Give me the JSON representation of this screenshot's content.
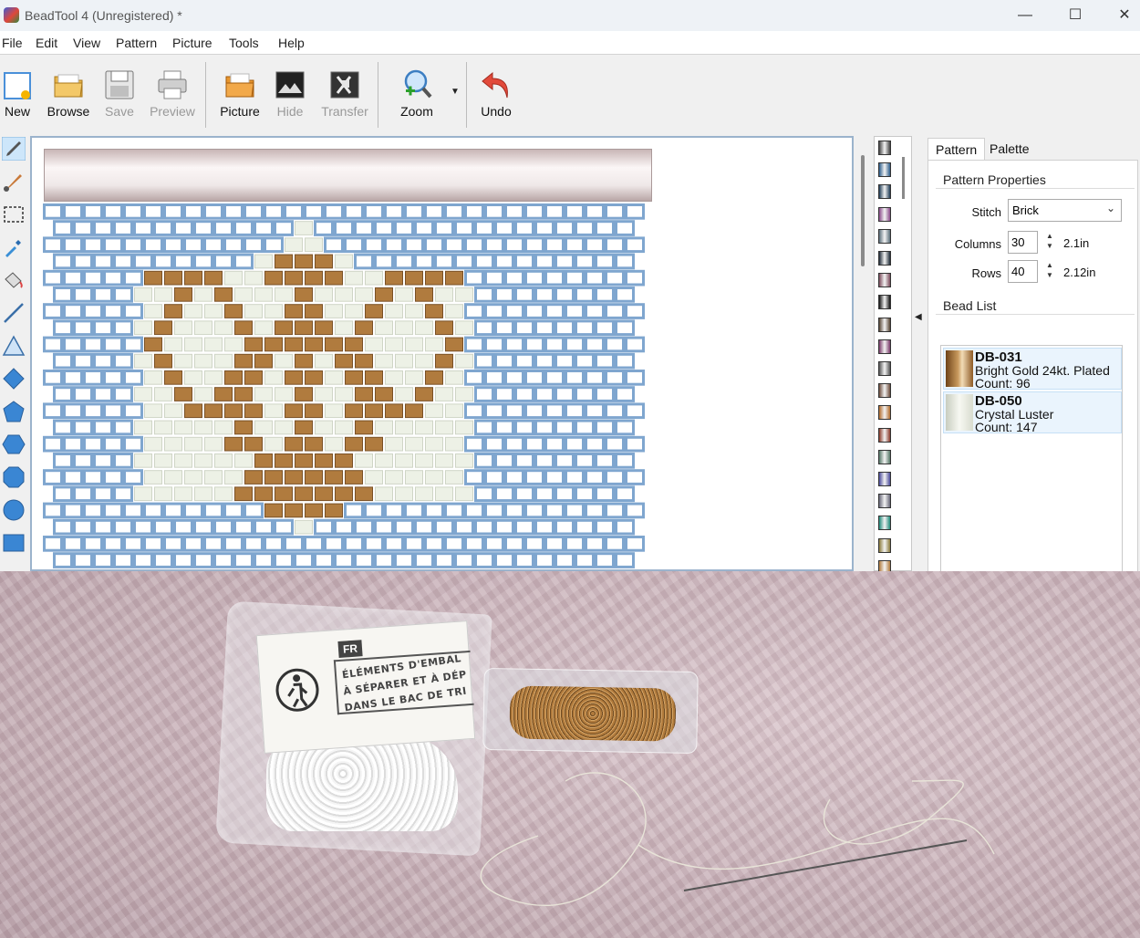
{
  "window": {
    "title": "BeadTool 4 (Unregistered) *"
  },
  "menu": [
    "File",
    "Edit",
    "View",
    "Pattern",
    "Picture",
    "Tools",
    "Help"
  ],
  "toolbar": {
    "new_label": "New",
    "browse_label": "Browse",
    "save_label": "Save",
    "preview_label": "Preview",
    "picture_label": "Picture",
    "hide_label": "Hide",
    "transfer_label": "Transfer",
    "zoom_label": "Zoom",
    "undo_label": "Undo"
  },
  "tools": [
    "pencil-icon",
    "brush-icon",
    "select-rect-icon",
    "eyedropper-icon",
    "fill-bucket-icon",
    "line-icon",
    "triangle-icon",
    "diamond-icon",
    "pentagon-icon",
    "hexagon-icon",
    "octagon-icon",
    "circle-icon",
    "rectangle-icon"
  ],
  "pattern": {
    "bead_colors": {
      "background": "#7fa6cf",
      "gold": "#b07b3e",
      "crystal": "#edf1e6"
    }
  },
  "palette_colors": [
    "#444444",
    "#2b5c8a",
    "#1f3b55",
    "#8a4a8a",
    "#5a6e7a",
    "#1e2a36",
    "#7a4a5a",
    "#111111",
    "#554433",
    "#7a3a6a",
    "#555555",
    "#6b4b3b",
    "#b06a2a",
    "#8a3a2a",
    "#557766",
    "#4a4a9a",
    "#666677",
    "#1f8a7a",
    "#8a7a3a",
    "#b07a3a"
  ],
  "right_panel": {
    "tabs": [
      "Pattern",
      "Palette"
    ],
    "pattern_properties": {
      "title": "Pattern Properties",
      "stitch_label": "Stitch",
      "stitch_value": "Brick",
      "columns_label": "Columns",
      "columns_value": "30",
      "columns_size": "2.1in",
      "rows_label": "Rows",
      "rows_value": "40",
      "rows_size": "2.12in"
    },
    "bead_list": {
      "title": "Bead List",
      "items": [
        {
          "code": "DB-031",
          "name": "Bright Gold 24kt. Plated",
          "count": "Count: 96",
          "color": "#b07b3e"
        },
        {
          "code": "DB-050",
          "name": "Crystal Luster",
          "count": "Count: 147",
          "color": "#e6ebe0"
        }
      ]
    }
  },
  "photo": {
    "label_lang": "FR",
    "label_lines": [
      "ÉLÉMENTS D'EMBAL",
      "À SÉPARER ET À DÉP",
      "DANS LE BAC DE TRI"
    ]
  }
}
